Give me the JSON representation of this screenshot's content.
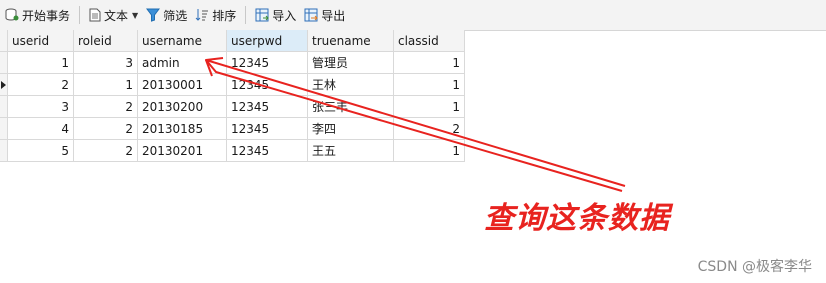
{
  "toolbar": {
    "begin_transaction": "开始事务",
    "text": "文本",
    "filter": "筛选",
    "sort": "排序",
    "import": "导入",
    "export": "导出"
  },
  "table": {
    "columns": [
      "userid",
      "roleid",
      "username",
      "userpwd",
      "truename",
      "classid"
    ],
    "rows": [
      [
        "1",
        "3",
        "admin",
        "12345",
        "管理员",
        "1"
      ],
      [
        "2",
        "1",
        "20130001",
        "12345",
        "王林",
        "1"
      ],
      [
        "3",
        "2",
        "20130200",
        "12345",
        "张三丰",
        "1"
      ],
      [
        "4",
        "2",
        "20130185",
        "12345",
        "李四",
        "2"
      ],
      [
        "5",
        "2",
        "20130201",
        "12345",
        "王五",
        "1"
      ]
    ],
    "selected_column": "userpwd",
    "current_row": 2
  },
  "annotation": {
    "text": "查询这条数据",
    "color": "#e8231f"
  },
  "watermark": "CSDN @极客李华",
  "colors": {
    "toolbar_bg": "#f3f3f3",
    "header_bg": "#f4f4f4",
    "selected_header": "#dcecf8",
    "arrow": "#e8231f"
  }
}
